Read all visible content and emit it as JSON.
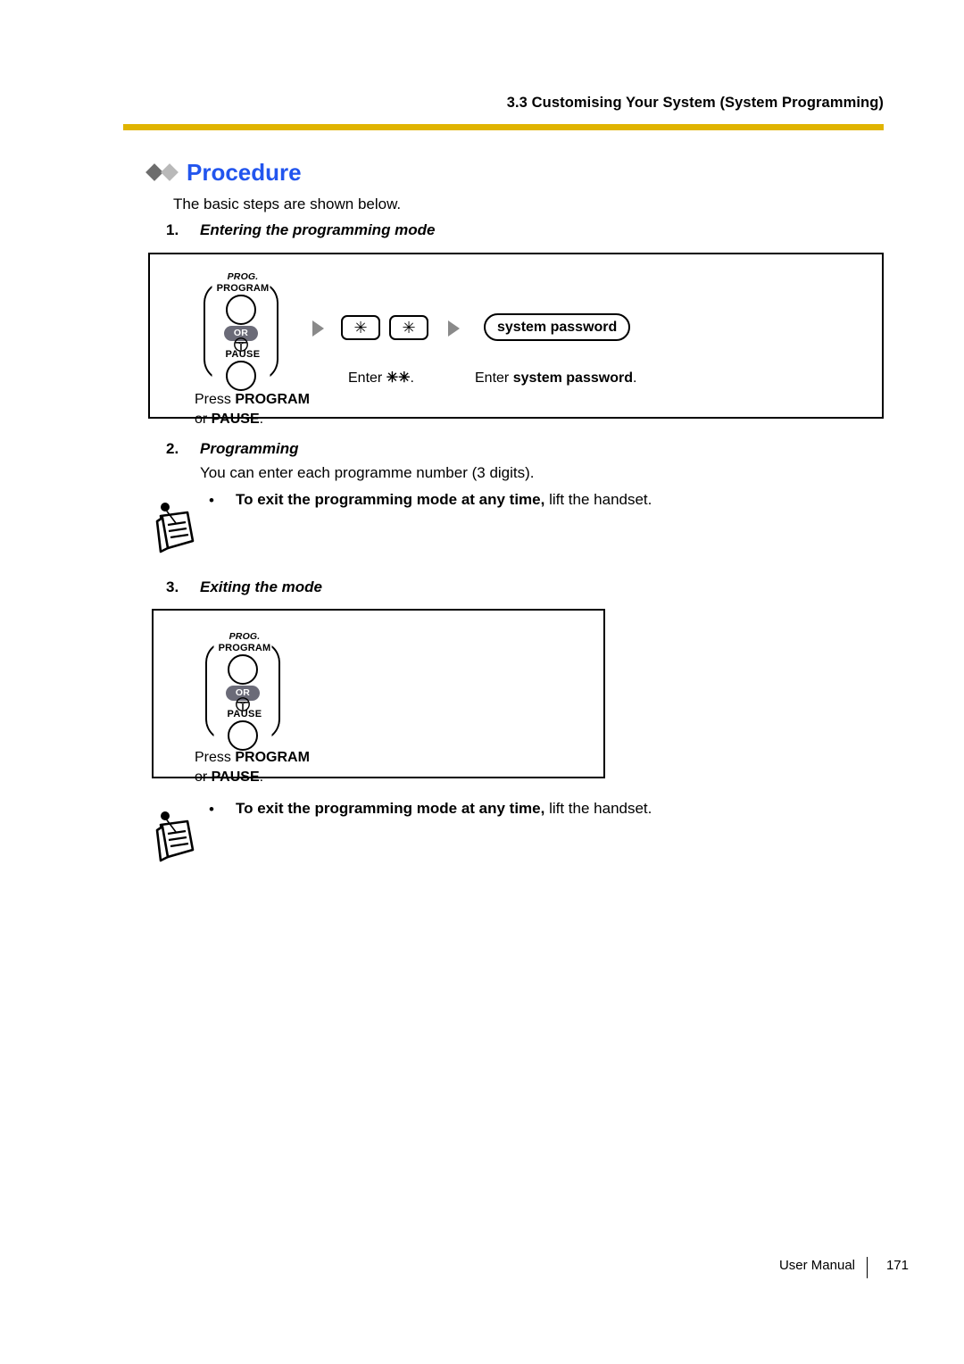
{
  "header": {
    "section_title": "3.3 Customising Your System (System Programming)",
    "rule_color": "#e0b400"
  },
  "procedure": {
    "title": "Procedure",
    "title_color": "#2255ee",
    "diamond_dark": "#6d6d6d",
    "diamond_light": "#b9b9b9",
    "intro": "The basic steps are shown below."
  },
  "steps": [
    {
      "number": "1.",
      "title": "Entering the programming mode"
    },
    {
      "number": "2.",
      "title": "Programming",
      "subtext": "You can enter each programme number (3 digits)."
    },
    {
      "number": "3.",
      "title": "Exiting the mode"
    }
  ],
  "notes": [
    {
      "icon": "note-paper-icon",
      "bullet": "•",
      "bold_text": "To exit the programming mode at any time,",
      "plain_text": " lift the handset."
    },
    {
      "icon": "note-paper-icon",
      "bullet": "•",
      "bold_text": "To exit the programming mode at any time,",
      "plain_text": " lift the handset."
    }
  ],
  "keygraphic": {
    "prog_italic": "PROG.",
    "prog_label": "PROGRAM",
    "or_label": "OR",
    "or_color": "#6b6b78",
    "pause_label": "PAUSE",
    "pause_icon": "pause-key-icon"
  },
  "diagram1": {
    "arrow1_icon": "flow-arrow-icon",
    "arrow2_icon": "flow-arrow-icon",
    "key1": "✳",
    "key2": "✳",
    "pill_label": "system password",
    "caption_press_plain": "Press ",
    "caption_press_bold": "PROGRAM",
    "caption_or_plain": "or ",
    "caption_or_bold": "PAUSE",
    "caption_or_period": ".",
    "caption_enter_plain": "Enter ",
    "caption_enter_bold": "✳✳",
    "caption_enter_period": ".",
    "caption_pw_plain": "Enter ",
    "caption_pw_bold": "system password",
    "caption_pw_period": "."
  },
  "diagram2": {
    "caption_press_plain": "Press ",
    "caption_press_bold": "PROGRAM",
    "caption_or_plain": "or ",
    "caption_or_bold": "PAUSE",
    "caption_or_period": "."
  },
  "footer": {
    "label": "User Manual",
    "page": "171"
  }
}
